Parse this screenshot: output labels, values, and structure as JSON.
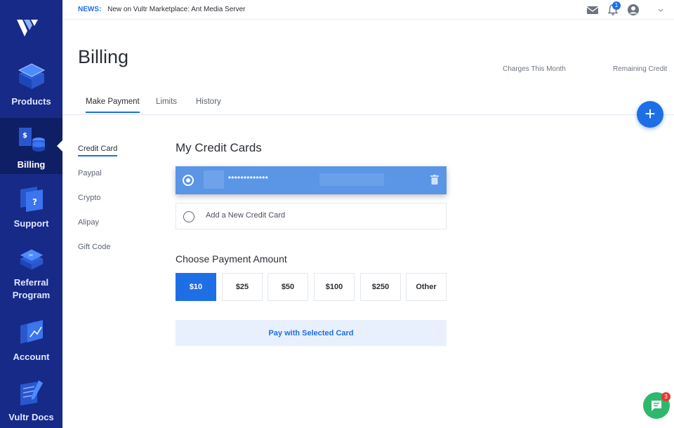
{
  "colors": {
    "sidebar": "#172a87",
    "sidebar_active": "#0f1f66",
    "accent": "#1e6fe6",
    "chat": "#2eb86b",
    "badge_red": "#e53935"
  },
  "sidebar": {
    "logo_icon": "vultr-logo-icon",
    "items": [
      {
        "label": "Products",
        "icon": "layers-icon"
      },
      {
        "label": "Billing",
        "icon": "billing-coins-icon"
      },
      {
        "label": "Support",
        "icon": "support-question-icon"
      },
      {
        "label": "Referral\nProgram",
        "icon": "referral-layers-icon"
      },
      {
        "label": "Account",
        "icon": "account-chart-icon"
      },
      {
        "label": "Vultr Docs",
        "icon": "docs-pen-icon"
      }
    ]
  },
  "topbar": {
    "news_tag": "NEWS:",
    "news_text": "New on Vultr Marketplace: Ant Media Server",
    "notification_count": "1",
    "icons": [
      "mail-icon",
      "bell-icon",
      "user-icon",
      "chevron-down-icon"
    ]
  },
  "page": {
    "title": "Billing",
    "charges_label": "Charges This Month",
    "remaining_label": "Remaining Credit"
  },
  "tabs": [
    "Make Payment",
    "Limits",
    "History"
  ],
  "fab_label": "+",
  "subnav": [
    "Credit Card",
    "Paypal",
    "Crypto",
    "Alipay",
    "Gift Code"
  ],
  "credit_cards": {
    "title": "My Credit Cards",
    "selected_card_number": "*************",
    "add_new_label": "Add a New Credit Card"
  },
  "payment": {
    "title": "Choose Payment Amount",
    "amounts": [
      "$10",
      "$25",
      "$50",
      "$100",
      "$250",
      "Other"
    ],
    "selected": "$10",
    "pay_button": "Pay with Selected Card"
  },
  "chat": {
    "badge_count": "3",
    "icon": "chat-icon"
  }
}
